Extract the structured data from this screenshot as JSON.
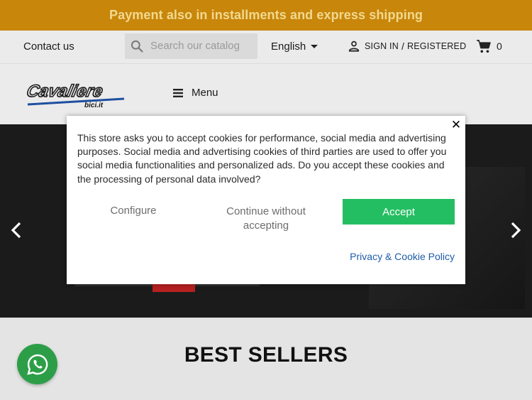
{
  "promo": {
    "text": "Payment also in installments and express shipping"
  },
  "nav": {
    "contact": "Contact us",
    "search_placeholder": "Search our catalog",
    "language": "English",
    "sign_in": "SIGN IN",
    "separator": "/",
    "register": "REGISTERED",
    "cart_count": "0"
  },
  "header": {
    "logo_main": "Cavaliere",
    "logo_sub": "bici.it",
    "menu_label": "Menu"
  },
  "cookie_modal": {
    "close": "✕",
    "message": "This store asks you to accept cookies for performance, social media and advertising purposes. Social media and advertising cookies of third parties are used to offer you social media functionalities and personalized ads. Do you accept these cookies and the processing of personal data involved?",
    "configure": "Configure",
    "continue_without": "Continue without accepting",
    "accept": "Accept",
    "policy_link": "Privacy & Cookie Policy"
  },
  "section": {
    "title": "BEST SELLERS"
  },
  "colors": {
    "promo_bg": "#c8860b",
    "accept_bg": "#24be62",
    "whatsapp_bg": "#2d9e48",
    "link": "#1d5ca8"
  },
  "icons": {
    "search": "search-icon",
    "caret": "chevron-down-icon",
    "user": "user-icon",
    "cart": "cart-icon",
    "menu": "hamburger-icon",
    "close": "close-icon",
    "prev": "chevron-left-icon",
    "next": "chevron-right-icon",
    "whatsapp": "whatsapp-icon"
  }
}
